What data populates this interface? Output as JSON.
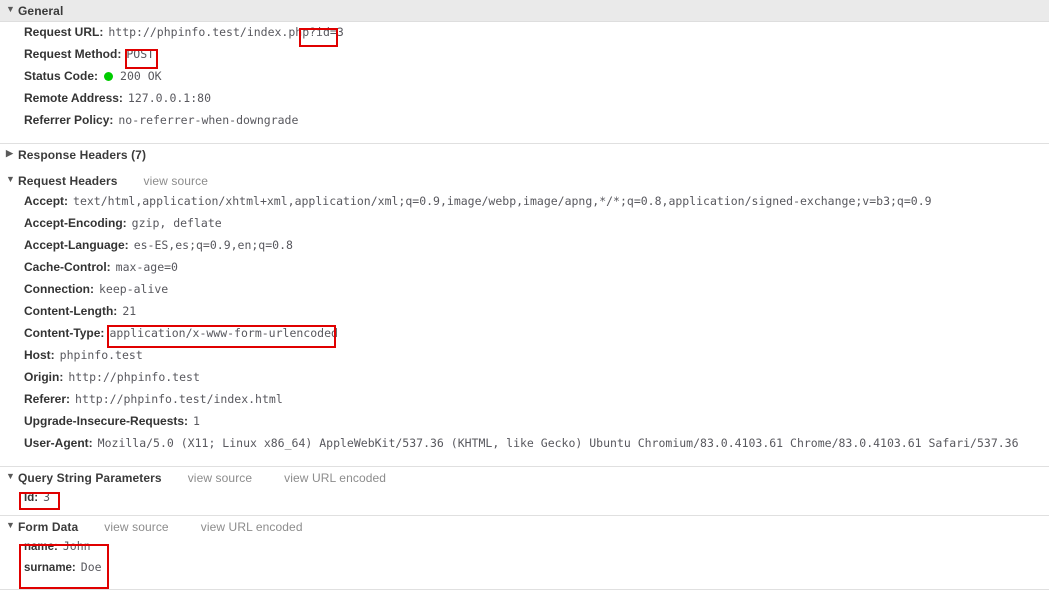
{
  "general": {
    "title": "General",
    "rows": [
      {
        "key": "Request URL:",
        "value": "http://phpinfo.test/index.php?id=3"
      },
      {
        "key": "Request Method:",
        "value": "POST"
      },
      {
        "key": "Status Code:",
        "value": "200 OK",
        "status_dot_color": "#00cc00"
      },
      {
        "key": "Remote Address:",
        "value": "127.0.0.1:80"
      },
      {
        "key": "Referrer Policy:",
        "value": "no-referrer-when-downgrade"
      }
    ]
  },
  "response_headers": {
    "title": "Response Headers (7)",
    "collapsed": true
  },
  "request_headers": {
    "title": "Request Headers",
    "view_source": "view source",
    "rows": [
      {
        "key": "Accept:",
        "value": "text/html,application/xhtml+xml,application/xml;q=0.9,image/webp,image/apng,*/*;q=0.8,application/signed-exchange;v=b3;q=0.9"
      },
      {
        "key": "Accept-Encoding:",
        "value": "gzip, deflate"
      },
      {
        "key": "Accept-Language:",
        "value": "es-ES,es;q=0.9,en;q=0.8"
      },
      {
        "key": "Cache-Control:",
        "value": "max-age=0"
      },
      {
        "key": "Connection:",
        "value": "keep-alive"
      },
      {
        "key": "Content-Length:",
        "value": "21"
      },
      {
        "key": "Content-Type:",
        "value": "application/x-www-form-urlencoded"
      },
      {
        "key": "Host:",
        "value": "phpinfo.test"
      },
      {
        "key": "Origin:",
        "value": "http://phpinfo.test"
      },
      {
        "key": "Referer:",
        "value": "http://phpinfo.test/index.html"
      },
      {
        "key": "Upgrade-Insecure-Requests:",
        "value": "1"
      },
      {
        "key": "User-Agent:",
        "value": "Mozilla/5.0 (X11; Linux x86_64) AppleWebKit/537.36 (KHTML, like Gecko) Ubuntu Chromium/83.0.4103.61 Chrome/83.0.4103.61 Safari/537.36"
      }
    ]
  },
  "query_string_parameters": {
    "title": "Query String Parameters",
    "view_source": "view source",
    "view_url_encoded": "view URL encoded",
    "rows": [
      {
        "key": "Id:",
        "value": "3"
      }
    ]
  },
  "form_data": {
    "title": "Form Data",
    "view_source": "view source",
    "view_url_encoded": "view URL encoded",
    "rows": [
      {
        "key": "name:",
        "value": "John"
      },
      {
        "key": "surname:",
        "value": "Doe"
      }
    ]
  },
  "annotations": {
    "highlight_color": "#e00000",
    "boxes": [
      {
        "name": "query-id-in-url",
        "target": "?id=3"
      },
      {
        "name": "request-method-value",
        "target": "POST"
      },
      {
        "name": "content-type-value",
        "target": "application/x-www-form-urlencoded"
      },
      {
        "name": "query-string-id-row",
        "target": "Id: 3"
      },
      {
        "name": "form-data-rows",
        "target": "name: John / surname: Doe"
      }
    ]
  }
}
